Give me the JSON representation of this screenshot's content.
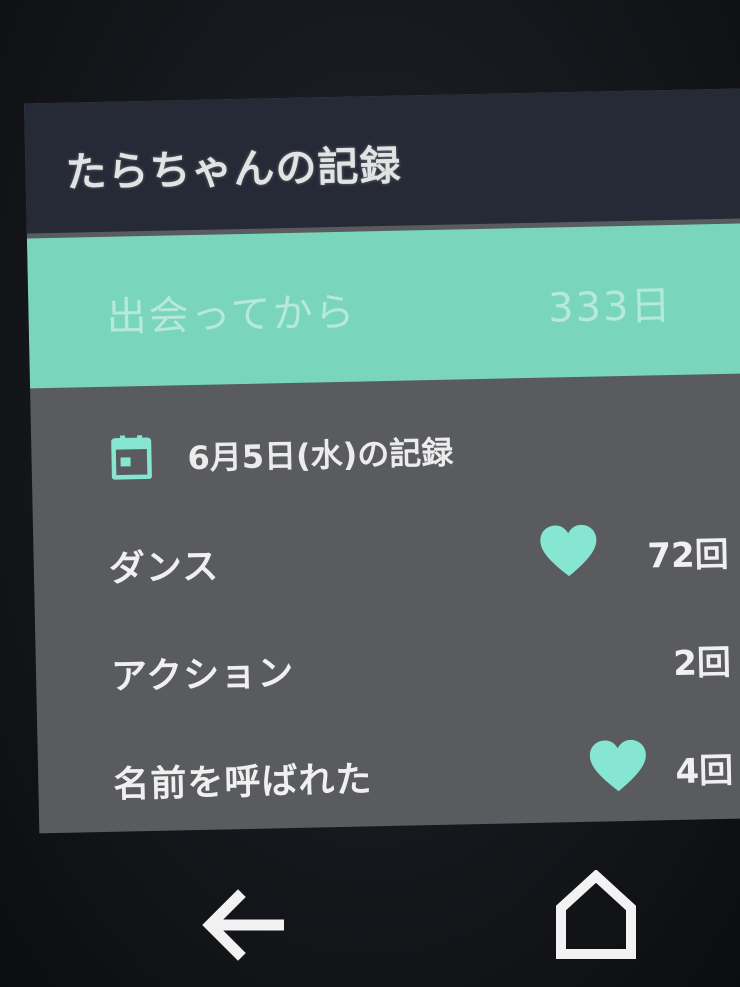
{
  "header": {
    "title": "たらちゃんの記録"
  },
  "banner": {
    "label": "出会ってから",
    "value": "333日"
  },
  "record": {
    "icon": "calendar-icon",
    "date_label": "6月5日(水)の記録"
  },
  "rows": [
    {
      "label": "ダンス",
      "count": "72回",
      "heart": true
    },
    {
      "label": "アクション",
      "count": "2回",
      "heart": false
    },
    {
      "label": "名前を呼ばれた",
      "count": "4回",
      "heart": true
    }
  ],
  "nav": {
    "back_icon": "back-arrow-icon",
    "home_icon": "home-icon"
  },
  "colors": {
    "header_bg": "#252a36",
    "banner_bg": "#79d6bd",
    "accent": "#86e6d2",
    "content_bg": "#595b5e"
  }
}
